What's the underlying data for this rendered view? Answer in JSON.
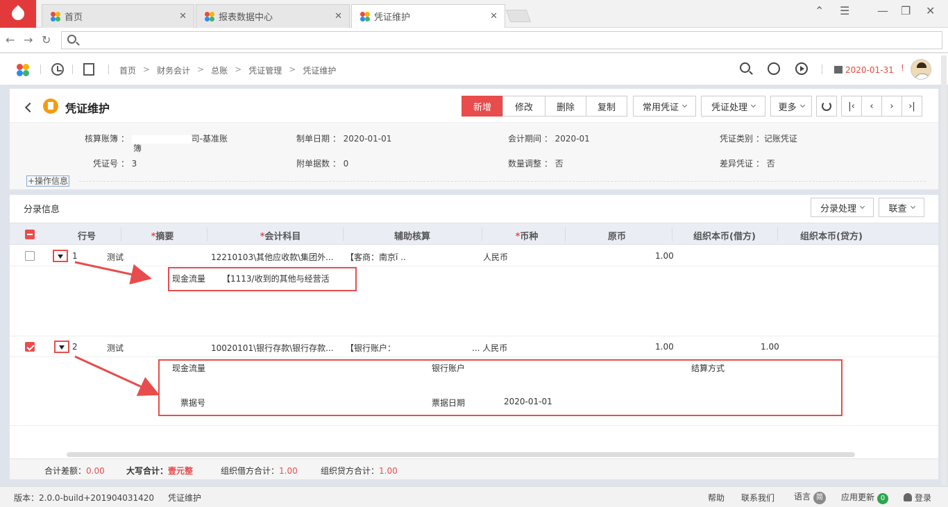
{
  "tabs": [
    {
      "label": "首页"
    },
    {
      "label": "报表数据中心"
    },
    {
      "label": "凭证维护"
    }
  ],
  "window_controls": {
    "minimize": "—",
    "restore": "❐",
    "close": "✕",
    "menu": "☰",
    "collapse": "⌃"
  },
  "breadcrumb": [
    "首页",
    "财务会计",
    "总账",
    "凭证管理",
    "凭证维护"
  ],
  "header": {
    "date": "2020-01-31",
    "alert": "!"
  },
  "page": {
    "title": "凭证维护",
    "buttons": [
      "新增",
      "修改",
      "删除",
      "复制"
    ],
    "dropdowns": [
      "常用凭证",
      "凭证处理",
      "更多"
    ],
    "nav": [
      "|‹",
      "‹",
      "›",
      "›|"
    ]
  },
  "info": {
    "ledger_label": "核算账簿",
    "ledger_value": "司-基准账",
    "ledger_value2": "簿",
    "date_label": "制单日期",
    "date_value": "2020-01-01",
    "period_label": "会计期间",
    "period_value": "2020-01",
    "type_label": "凭证类别",
    "type_value": "记账凭证",
    "no_label": "凭证号",
    "no_value": "3",
    "attach_label": "附单据数",
    "attach_value": "0",
    "qty_label": "数量调整",
    "qty_value": "否",
    "diff_label": "差异凭证",
    "diff_value": "否",
    "op_info": "+操作信息"
  },
  "entries": {
    "title": "分录信息",
    "dropdowns": [
      "分录处理",
      "联查"
    ],
    "columns": [
      {
        "label": "行号",
        "req": ""
      },
      {
        "label": "摘要",
        "req": "*"
      },
      {
        "label": "会计科目",
        "req": "*"
      },
      {
        "label": "辅助核算",
        "req": ""
      },
      {
        "label": "币种",
        "req": "*"
      },
      {
        "label": "原币",
        "req": ""
      },
      {
        "label": "组织本币(借方)",
        "req": ""
      },
      {
        "label": "组织本币(贷方)",
        "req": ""
      }
    ],
    "rows": [
      {
        "no": "1",
        "summary": "测试",
        "account": "12210103\\其他应收款\\集团外...",
        "aux": "【客商：南京ī ..",
        "currency": "人民币",
        "orig": "1.00",
        "debit": "",
        "credit": ""
      },
      {
        "no": "2",
        "summary": "测试",
        "account": "10020101\\银行存款\\银行存款...",
        "aux": "【银行账户：",
        "currency": "... 人民币",
        "orig": "1.00",
        "debit": "1.00",
        "credit": ""
      }
    ],
    "detail1": {
      "cash_flow_label": "现金流量",
      "cash_flow_value": "【1113/收到的其他与经营活"
    },
    "detail2": {
      "cash_flow_label": "现金流量",
      "bank_account_label": "银行账户",
      "settle_label": "结算方式",
      "bill_no_label": "票据号",
      "bill_date_label": "票据日期",
      "bill_date_value": "2020-01-01"
    }
  },
  "totals": {
    "diff_label": "合计差额：",
    "diff_value": "0.00",
    "upper_label": "大写合计：",
    "upper_value": "壹元整",
    "debit_label": "组织借方合计：",
    "debit_value": "1.00",
    "credit_label": "组织贷方合计：",
    "credit_value": "1.00"
  },
  "status": {
    "version": "版本：2.0.0-build+201904031420",
    "page": "凭证维护",
    "help": "帮助",
    "contact": "联系我们",
    "lang": "语言",
    "lang_badge": "简",
    "update": "应用更新",
    "update_count": "0",
    "login": "登录"
  },
  "colors": {
    "accent": "#e84c4c",
    "date": "#e94b3c"
  }
}
